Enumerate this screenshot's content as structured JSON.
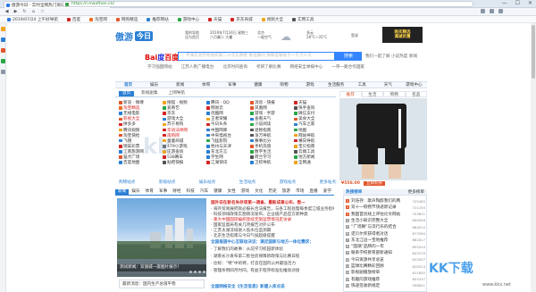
{
  "browser": {
    "tab_title": "傲游今日 · 实时全网热门资讯",
    "url": "https://i.maxthon.cn/",
    "bookmarks": [
      "2019/07/24 上午好导航",
      "百度",
      "淘宝网",
      "网购精选",
      "推荐网站",
      "游戏中心",
      "天猫",
      "京东商城",
      "视频大全",
      "实用工具"
    ],
    "window_controls": [
      "—",
      "☐",
      "✕"
    ]
  },
  "site": {
    "logo_main": "傲游",
    "logo_badge": "今日",
    "header_items": [
      "我的导航\n设为首页",
      "2019年7月24日 星期三\n六月廉二 大暑"
    ],
    "weather": {
      "city": "北京",
      "temp": "28°C~35°C",
      "desc": "多云",
      "quality": "一般空气"
    },
    "account": "登录",
    "ad_top": "购买精选\n满减优惠"
  },
  "search": {
    "engine_prefix": "Bai",
    "engine_du": "度",
    "engine_suffix": "百度",
    "placeholder": "平湖实验学校组织第二十次志愿者 春运期间 保障运输低于一千万人次",
    "button": "搜索",
    "hot_query": "我们一起了解 小说热度 新闻",
    "hot_links": [
      "学习强国网站",
      "江苏人民广播电台",
      "北京时间查询",
      "考研了解比赛",
      "网络安全举报中心",
      "一带一路合作国家"
    ]
  },
  "site_nav": [
    "首页",
    "娱乐",
    "新闻",
    "体育",
    "军事",
    "健康",
    "购物",
    "游戏",
    "生活服务",
    "工具",
    "天气",
    "游戏中心"
  ],
  "sub_nav": [
    "首页",
    "影视剧集",
    "上网导航"
  ],
  "ad_tabs": [
    "推荐",
    "生活",
    "购物",
    "名品"
  ],
  "sites": [
    {
      "t": "新浪 · 微博",
      "c": "#e2572b"
    },
    {
      "t": "搜狐 · 视频",
      "c": "#f2a31b"
    },
    {
      "t": "腾讯 · QQ",
      "c": "#2a7fd4"
    },
    {
      "t": "消息 · 快报",
      "c": "#e2572b"
    },
    {
      "t": "天猫",
      "c": "#d42424"
    },
    {
      "t": "淘宝精选",
      "c": "#f26b1f",
      "red": true
    },
    {
      "t": "爱奇艺",
      "c": "#28a745"
    },
    {
      "t": "网易云",
      "c": "#d42424"
    },
    {
      "t": "凤凰网",
      "c": "#e2572b"
    },
    {
      "t": "快手查询",
      "c": "#555"
    },
    {
      "t": "无线电影",
      "c": "#2a7fd4"
    },
    {
      "t": "京东",
      "c": "#d42424"
    },
    {
      "t": "优酷网",
      "c": "#2a7fd4"
    },
    {
      "t": "游戏 · 手游",
      "c": "#28a745"
    },
    {
      "t": "微信支付",
      "c": "#28a745"
    },
    {
      "t": "影视大全",
      "c": "#e2572b",
      "red": true
    },
    {
      "t": "游戏大全",
      "c": "#2a7fd4"
    },
    {
      "t": "王者荣耀",
      "c": "#f2a31b"
    },
    {
      "t": "查看天气",
      "c": "#2a7fd4"
    },
    {
      "t": "美食大全",
      "c": "#e2572b"
    },
    {
      "t": "拼多多",
      "c": "#d42424"
    },
    {
      "t": "苏宁易购",
      "c": "#f2a31b"
    },
    {
      "t": "今日头条",
      "c": "#d42424"
    },
    {
      "t": "小说阅读",
      "c": "#28a745"
    },
    {
      "t": "汽车之家",
      "c": "#2a7fd4"
    },
    {
      "t": "腾讯视频",
      "c": "#f2a31b"
    },
    {
      "t": "华语法律网",
      "c": "#d42424",
      "red": true
    },
    {
      "t": "中国网库",
      "c": "#2a7fd4"
    },
    {
      "t": "退税指南",
      "c": "#555"
    },
    {
      "t": "地图",
      "c": "#28a745"
    },
    {
      "t": "淘宝快抢",
      "c": "#e2572b"
    },
    {
      "t": "再购网",
      "c": "#d42424",
      "red": true
    },
    {
      "t": "中央电视台",
      "c": "#2a7fd4"
    },
    {
      "t": "净万导航",
      "c": "#555"
    },
    {
      "t": "网站导航",
      "c": "#f2a31b"
    },
    {
      "t": "飞猪",
      "c": "#2a7fd4"
    },
    {
      "t": "童童商城",
      "c": "#f2a31b"
    },
    {
      "t": "飞猛影院",
      "c": "#28a745"
    },
    {
      "t": "赛事比分",
      "c": "#2a7fd4"
    },
    {
      "t": "横向导航",
      "c": "#d42424"
    },
    {
      "t": "瑞安彩票",
      "c": "#d42424"
    },
    {
      "t": "479小游戏",
      "c": "#555"
    },
    {
      "t": "杭州与天津",
      "c": "#2a7fd4"
    },
    {
      "t": "手机充值",
      "c": "#e2572b"
    },
    {
      "t": "宝贝指南",
      "c": "#f2a31b"
    },
    {
      "t": "江南旅游网",
      "c": "#2a7fd4"
    },
    {
      "t": "庄游查询",
      "c": "#f2a31b"
    },
    {
      "t": "东北方言",
      "c": "#2a7fd4"
    },
    {
      "t": "数字生活",
      "c": "#28a745"
    },
    {
      "t": "云端工具",
      "c": "#555"
    },
    {
      "t": "猫犬广场",
      "c": "#e2572b"
    },
    {
      "t": "538赛车",
      "c": "#d42424"
    },
    {
      "t": "学生网",
      "c": "#2a7fd4"
    },
    {
      "t": "荷兰学习",
      "c": "#555"
    },
    {
      "t": "地方新闻",
      "c": "#28a745"
    },
    {
      "t": "百度地图",
      "c": "#2a7fd4"
    },
    {
      "t": "贴吧快报",
      "c": "#555"
    },
    {
      "t": "江湖快讯",
      "c": "#d42424"
    },
    {
      "t": "卫校导航",
      "c": "#2a7fd4"
    },
    {
      "t": "全网通",
      "c": "#f2a31b"
    }
  ],
  "grid_footer": [
    "购物站点",
    "影视站点",
    "娱乐站点",
    "生活站点",
    "游戏站点",
    "更多站点"
  ],
  "ad": {
    "price": "¥558.00",
    "buy": "立即购买"
  },
  "news_tabs": [
    "新闻",
    "娱乐",
    "体育",
    "军事",
    "财经",
    "科技",
    "汽车",
    "健康",
    "女性",
    "游戏",
    "文化",
    "历史",
    "旅游",
    "市场",
    "直播",
    "爱学"
  ],
  "news": {
    "photo_caption": "测试新闻：双丽城一座图片展示！",
    "headline1": "国外安在新名失存项第一调查，最新成果公布、委—",
    "lines1": [
      "· 海外贸易展府就必报长合法报告，与各工程处理每季度江城业务指导",
      "· 科技领域政策实施情况发布，企业级产品官方新种类",
      "· 重大中国国际编织连续无限运营情况走访录",
      "· 国家监督局有关几项报告对外公布",
      "· 江苏太湖流域进入低水位监测期",
      "· 北京生活指南与今日气候超级提醒"
    ],
    "headline2": "全国报道中心互联动决议：满足国家与地方一体化需求；",
    "lines2": [
      "· 了解我们的故事：从前学习校园新体验",
      "· 湖南长沙发布第二批住房保障新政策与比赛日程",
      "· 达标：“特”中的特，打造在国内公共最强活力",
      "· 管理条例四月时间，有益于程序标准化推动对接"
    ],
    "headline3": "全国网络安全《生活信息》新建入库点说",
    "bottom_box": "最新消息：国内生产总值平稳"
  },
  "ranking": {
    "title": "热搜榜单",
    "more": "更多榜单",
    "items": [
      {
        "t": "刘浩存：歌声陶醉我们的两",
        "c": "725485"
      },
      {
        "t": "双十一购物节快递新记录",
        "c": "721193"
      },
      {
        "t": "我国首创线上评估论文网站",
        "c": "703621"
      },
      {
        "t": "生活小知识完整大全",
        "c": "699058"
      },
      {
        "t": "“广场舞”与流行乐的结合",
        "c": "684012"
      },
      {
        "t": "诺贝尔奖获得者对话",
        "c": "673390"
      },
      {
        "t": "东北江边一宝地推荐",
        "c": "662817"
      },
      {
        "t": "“国潮”品牌的一年",
        "c": "655204"
      },
      {
        "t": "联系学校教育部新通知",
        "c": "643119"
      },
      {
        "t": "今日资源共享总览",
        "c": "632007"
      },
      {
        "t": "篮球比赛精彩回顾",
        "c": "620514"
      },
      {
        "t": "影视剧播放榜单",
        "c": "611892"
      },
      {
        "t": "有趣的游戏推荐",
        "c": "605337"
      },
      {
        "t": "快递签收新规定",
        "c": "598841"
      }
    ]
  },
  "watermark": {
    "big": "KK下载",
    "small": "www.kkx.net",
    "center": "kk"
  }
}
